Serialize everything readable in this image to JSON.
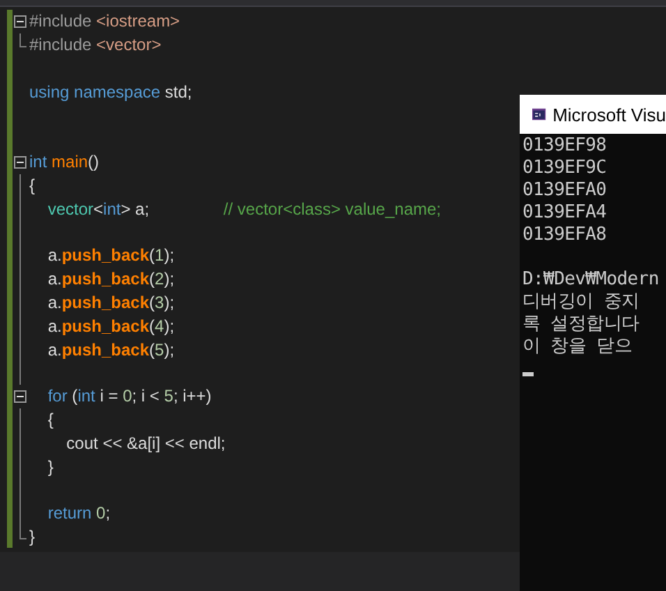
{
  "editor": {
    "lines": [
      {
        "kind": "fold",
        "expanded": true,
        "tokens": [
          {
            "kind": "preproc",
            "text": "#include"
          },
          {
            "kind": "string",
            "text": " <iostream>"
          }
        ],
        "children": [
          {
            "kind": "code",
            "tokens": [
              {
                "kind": "preproc",
                "text": "#include"
              },
              {
                "kind": "string",
                "text": " <vector>"
              }
            ]
          }
        ]
      },
      {
        "kind": "blank"
      },
      {
        "kind": "code",
        "tokens": [
          {
            "kind": "keyword",
            "text": "using"
          },
          {
            "kind": "keyword",
            "text": " namespace"
          },
          {
            "kind": "plain",
            "text": " std;"
          }
        ]
      },
      {
        "kind": "blank"
      },
      {
        "kind": "blank"
      },
      {
        "kind": "fold",
        "expanded": true,
        "tokens": [
          {
            "kind": "keyword",
            "text": "int"
          },
          {
            "kind": "function",
            "text": " main"
          },
          {
            "kind": "plain",
            "text": "()"
          }
        ],
        "children": [
          {
            "kind": "code",
            "tokens": [
              {
                "kind": "plain",
                "text": "{"
              }
            ]
          },
          {
            "kind": "code",
            "tokens": [
              {
                "kind": "type",
                "text": "    vector"
              },
              {
                "kind": "plain",
                "text": "<"
              },
              {
                "kind": "keyword",
                "text": "int"
              },
              {
                "kind": "plain",
                "text": "> a;                "
              },
              {
                "kind": "comment",
                "text": "// vector<class> value_name;"
              }
            ]
          },
          {
            "kind": "blank"
          },
          {
            "kind": "code",
            "tokens": [
              {
                "kind": "plain",
                "text": "    a."
              },
              {
                "kind": "method",
                "text": "push_back"
              },
              {
                "kind": "plain",
                "text": "("
              },
              {
                "kind": "number",
                "text": "1"
              },
              {
                "kind": "plain",
                "text": ");"
              }
            ]
          },
          {
            "kind": "code",
            "tokens": [
              {
                "kind": "plain",
                "text": "    a."
              },
              {
                "kind": "method",
                "text": "push_back"
              },
              {
                "kind": "plain",
                "text": "("
              },
              {
                "kind": "number",
                "text": "2"
              },
              {
                "kind": "plain",
                "text": ");"
              }
            ]
          },
          {
            "kind": "code",
            "tokens": [
              {
                "kind": "plain",
                "text": "    a."
              },
              {
                "kind": "method",
                "text": "push_back"
              },
              {
                "kind": "plain",
                "text": "("
              },
              {
                "kind": "number",
                "text": "3"
              },
              {
                "kind": "plain",
                "text": ");"
              }
            ]
          },
          {
            "kind": "code",
            "tokens": [
              {
                "kind": "plain",
                "text": "    a."
              },
              {
                "kind": "method",
                "text": "push_back"
              },
              {
                "kind": "plain",
                "text": "("
              },
              {
                "kind": "number",
                "text": "4"
              },
              {
                "kind": "plain",
                "text": ");"
              }
            ]
          },
          {
            "kind": "code",
            "tokens": [
              {
                "kind": "plain",
                "text": "    a."
              },
              {
                "kind": "method",
                "text": "push_back"
              },
              {
                "kind": "plain",
                "text": "("
              },
              {
                "kind": "number",
                "text": "5"
              },
              {
                "kind": "plain",
                "text": ");"
              }
            ]
          },
          {
            "kind": "blank"
          },
          {
            "kind": "fold",
            "expanded": true,
            "tokens": [
              {
                "kind": "keyword",
                "text": "    for"
              },
              {
                "kind": "plain",
                "text": " ("
              },
              {
                "kind": "keyword",
                "text": "int"
              },
              {
                "kind": "plain",
                "text": " i = "
              },
              {
                "kind": "number",
                "text": "0"
              },
              {
                "kind": "plain",
                "text": "; i < "
              },
              {
                "kind": "number",
                "text": "5"
              },
              {
                "kind": "plain",
                "text": "; i++)"
              }
            ],
            "children": [
              {
                "kind": "code",
                "tokens": [
                  {
                    "kind": "plain",
                    "text": "    {"
                  }
                ]
              },
              {
                "kind": "code",
                "tokens": [
                  {
                    "kind": "plain",
                    "text": "        cout << &a[i] << endl;"
                  }
                ]
              },
              {
                "kind": "code",
                "tokens": [
                  {
                    "kind": "plain",
                    "text": "    }"
                  }
                ]
              }
            ]
          },
          {
            "kind": "blank"
          },
          {
            "kind": "code",
            "tokens": [
              {
                "kind": "keyword",
                "text": "    return"
              },
              {
                "kind": "number",
                "text": " 0"
              },
              {
                "kind": "plain",
                "text": ";"
              }
            ]
          },
          {
            "kind": "code",
            "tokens": [
              {
                "kind": "plain",
                "text": "}"
              }
            ]
          }
        ]
      }
    ]
  },
  "console": {
    "title": "Microsoft Visu",
    "lines": [
      {
        "kind": "output",
        "text": "0139EF98"
      },
      {
        "kind": "output",
        "text": "0139EF9C"
      },
      {
        "kind": "output",
        "text": "0139EFA0"
      },
      {
        "kind": "output",
        "text": "0139EFA4"
      },
      {
        "kind": "output",
        "text": "0139EFA8"
      },
      {
        "kind": "blank"
      },
      {
        "kind": "output",
        "text": "D:₩Dev₩Modern"
      },
      {
        "kind": "output",
        "text": "디버깅이 중지"
      },
      {
        "kind": "output",
        "text": "록 설정합니다"
      },
      {
        "kind": "output",
        "text": "이 창을 닫으"
      }
    ]
  }
}
